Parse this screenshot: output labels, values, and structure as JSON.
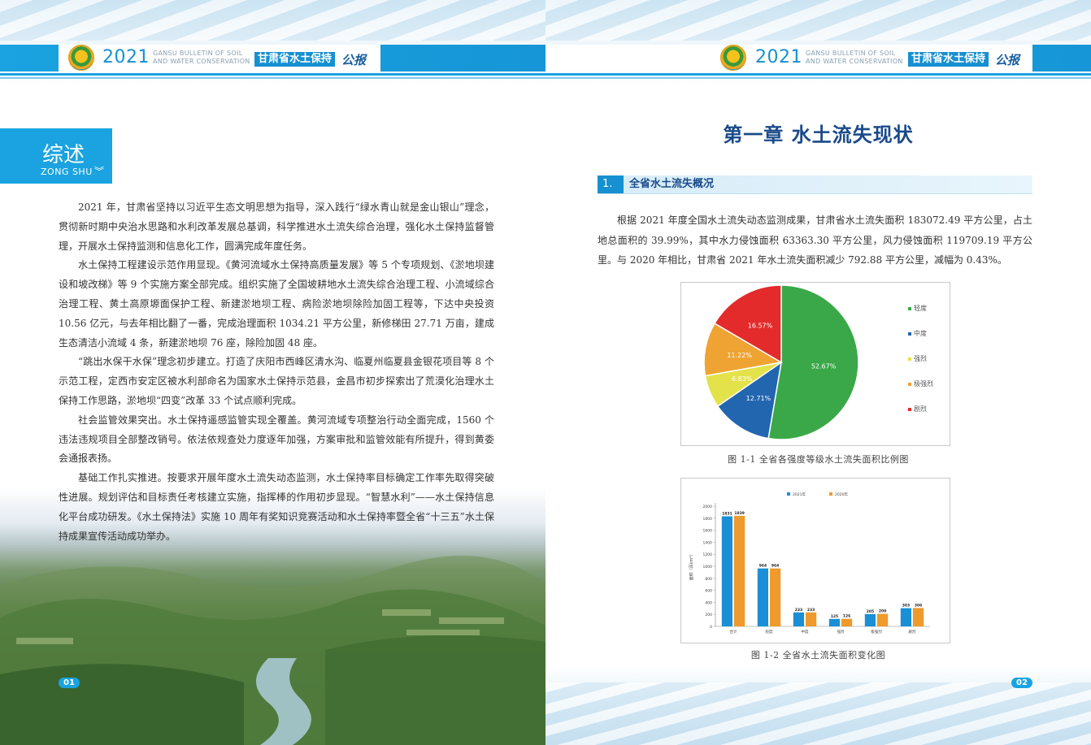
{
  "header": {
    "year": "2021",
    "en_line1": "GANSU BULLETIN OF SOIL",
    "en_line2": "AND WATER CONSERVATION",
    "cn_title": "甘肃省水土保持",
    "cn_suffix": "公报"
  },
  "left_page": {
    "section_cn": "综述",
    "section_en": "ZONG SHU",
    "paragraphs": [
      "2021 年，甘肃省坚持以习近平生态文明思想为指导，深入践行“绿水青山就是金山银山”理念，贯彻新时期中央治水思路和水利改革发展总基调，科学推进水土流失综合治理，强化水土保持监督管理，开展水土保持监测和信息化工作，圆满完成年度任务。",
      "水土保持工程建设示范作用显现。《黄河流域水土保持高质量发展》等 5 个专项规划、《淤地坝建设和坡改梯》等 9 个实施方案全部完成。组织实施了全国坡耕地水土流失综合治理工程、小流域综合治理工程、黄土高原塬面保护工程、新建淤地坝工程、病险淤地坝除险加固工程等，下达中央投资 10.56 亿元，与去年相比翻了一番，完成治理面积 1034.21 平方公里，新修梯田 27.71 万亩，建成生态清洁小流域 4 条，新建淤地坝 76 座，除险加固 48 座。",
      "“跳出水保干水保”理念初步建立。打造了庆阳市西峰区清水沟、临夏州临夏县金银花项目等 8 个示范工程，定西市安定区被水利部命名为国家水土保持示范县，金昌市初步探索出了荒漠化治理水土保持工作思路，淤地坝“四变”改革 33 个试点顺利完成。",
      "社会监管效果突出。水土保持遥感监管实现全覆盖。黄河流域专项整治行动全面完成，1560 个违法违规项目全部整改销号。依法依规查处力度逐年加强，方案审批和监管效能有所提升，得到黄委会通报表扬。",
      "基础工作扎实推进。按要求开展年度水土流失动态监测，水土保持率目标确定工作率先取得突破性进展。规划评估和目标责任考核建立实施，指挥棒的作用初步显现。“智慧水利”——水土保持信息化平台成功研发。《水土保持法》实施 10 周年有奖知识竞赛活动和水土保持率暨全省“十三五”水土保持成果宣传活动成功举办。"
    ],
    "page_number": "01"
  },
  "right_page": {
    "chapter_title": "第一章  水土流失现状",
    "section_num": "1.",
    "section_title": "全省水土流失概况",
    "paragraph": "根据 2021 年度全国水土流失动态监测成果，甘肃省水土流失面积 183072.49 平方公里，占土地总面积的 39.99%，其中水力侵蚀面积 63363.30 平方公里，风力侵蚀面积 119709.19 平方公里。与 2020 年相比，甘肃省 2021 年水土流失面积减少 792.88 平方公里，减幅为 0.43%。",
    "caption1": "图 1-1 全省各强度等级水土流失面积比例图",
    "caption2": "图 1-2 全省水土流失面积变化图",
    "page_number": "02"
  },
  "chart_data": [
    {
      "type": "pie",
      "labels": [
        "轻度",
        "中度",
        "强烈",
        "极强烈",
        "剧烈"
      ],
      "values": [
        52.67,
        12.71,
        6.83,
        11.22,
        16.57
      ],
      "value_labels": [
        "52.67%",
        "12.71%",
        "6.83%",
        "11.22%",
        "16.57%"
      ],
      "colors": [
        "#3aa848",
        "#2266b0",
        "#e4e24a",
        "#eea333",
        "#e32b2b"
      ],
      "legend": "right"
    },
    {
      "type": "bar",
      "categories": [
        "合计",
        "轻度",
        "中度",
        "强烈",
        "极强烈",
        "剧烈"
      ],
      "series": [
        {
          "name": "2021年",
          "values": [
            1831,
            964,
            233,
            125,
            205,
            303
          ],
          "color": "#1a8fd6"
        },
        {
          "name": "2020年",
          "values": [
            1839,
            964,
            233,
            126,
            209,
            306
          ],
          "color": "#ee9a2c"
        }
      ],
      "ylabel": "面积（百km²）",
      "ylim": [
        0,
        2000
      ],
      "yticks": [
        0,
        200,
        400,
        600,
        800,
        1000,
        1200,
        1400,
        1600,
        1800,
        2000
      ],
      "legend": "top"
    }
  ]
}
